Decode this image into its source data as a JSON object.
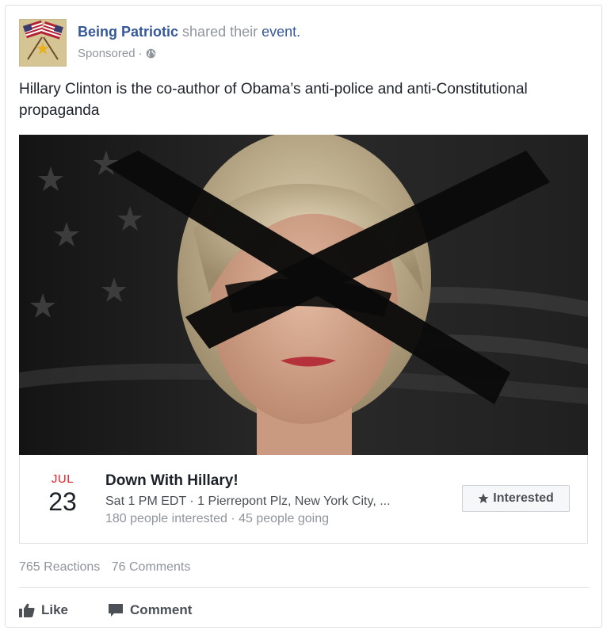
{
  "post": {
    "page_name": "Being Patriotic",
    "action_text": "shared their",
    "event_link": "event.",
    "sponsored_label": "Sponsored",
    "separator": "·",
    "privacy_icon": "globe-icon",
    "text": "Hillary Clinton is the co-author of Obama’s anti-police and anti-Constitutional propaganda"
  },
  "event": {
    "month": "JUL",
    "day": "23",
    "title": "Down With Hillary!",
    "meta": "Sat 1 PM EDT · 1 Pierrepont Plz, New York City, ...",
    "stats": "180 people interested · 45 people going",
    "interested_label": "Interested",
    "interested_icon": "star-icon"
  },
  "engagement": {
    "reactions": "765 Reactions",
    "comments": "76 Comments"
  },
  "actions": {
    "like_label": "Like",
    "comment_label": "Comment"
  },
  "colors": {
    "link_blue": "#365899",
    "date_red": "#e41c26",
    "muted_gray": "#90949c"
  }
}
